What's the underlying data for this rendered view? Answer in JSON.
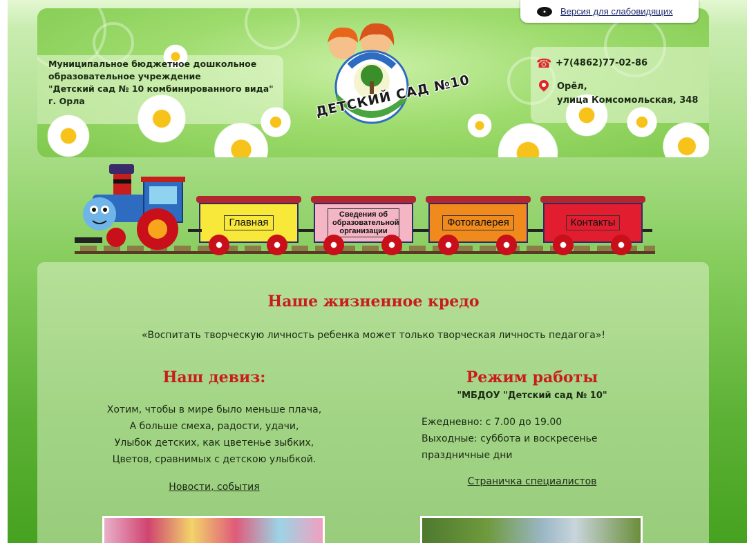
{
  "accessibility": {
    "label": "Версия для слабовидящих"
  },
  "header": {
    "org_lines": [
      "Муниципальное бюджетное дошкольное",
      "образовательное учреждение",
      "\"Детский сад № 10 комбинированного вида\"",
      "г. Орла"
    ],
    "logo_text": "ДЕТСКИЙ САД №10",
    "phone": "+7(4862)77-02-86",
    "address_line1": "Орёл,",
    "address_line2": "улица Комсомольская, 348"
  },
  "nav": {
    "items": [
      {
        "label": "Главная",
        "color": "#f7e83a"
      },
      {
        "label": "Сведения об образовательной организации",
        "color": "#f4b6c4"
      },
      {
        "label": "Фотогалерея",
        "color": "#f08a1c"
      },
      {
        "label": "Контакты",
        "color": "#e11d2f"
      }
    ]
  },
  "main": {
    "credo_title": "Наше жизненное кредо",
    "credo_quote": "«Воспитать творческую личность ребенка может только творческая личность педагога»!",
    "motto_title": "Наш девиз:",
    "poem": [
      "Хотим, чтобы в мире было меньше плача,",
      "А больше смеха, радости, удачи,",
      "Улыбок детских, как цветенье зыбких,",
      "Цветов, сравнимых с детскою улыбкой."
    ],
    "news_link": "Новости, события",
    "hours_title": "Режим работы",
    "hours_subtitle": "\"МБДОУ \"Детский сад № 10\"",
    "hours": [
      "Ежедневно: с 7.00 до 19.00",
      "Выходные: суббота и воскресенье",
      "праздничные дни"
    ],
    "specialists_link": "Страничка специалистов"
  },
  "colors": {
    "accent_red": "#c81d1d",
    "text_dark": "#1b2a14",
    "green": "#86cd5d"
  }
}
